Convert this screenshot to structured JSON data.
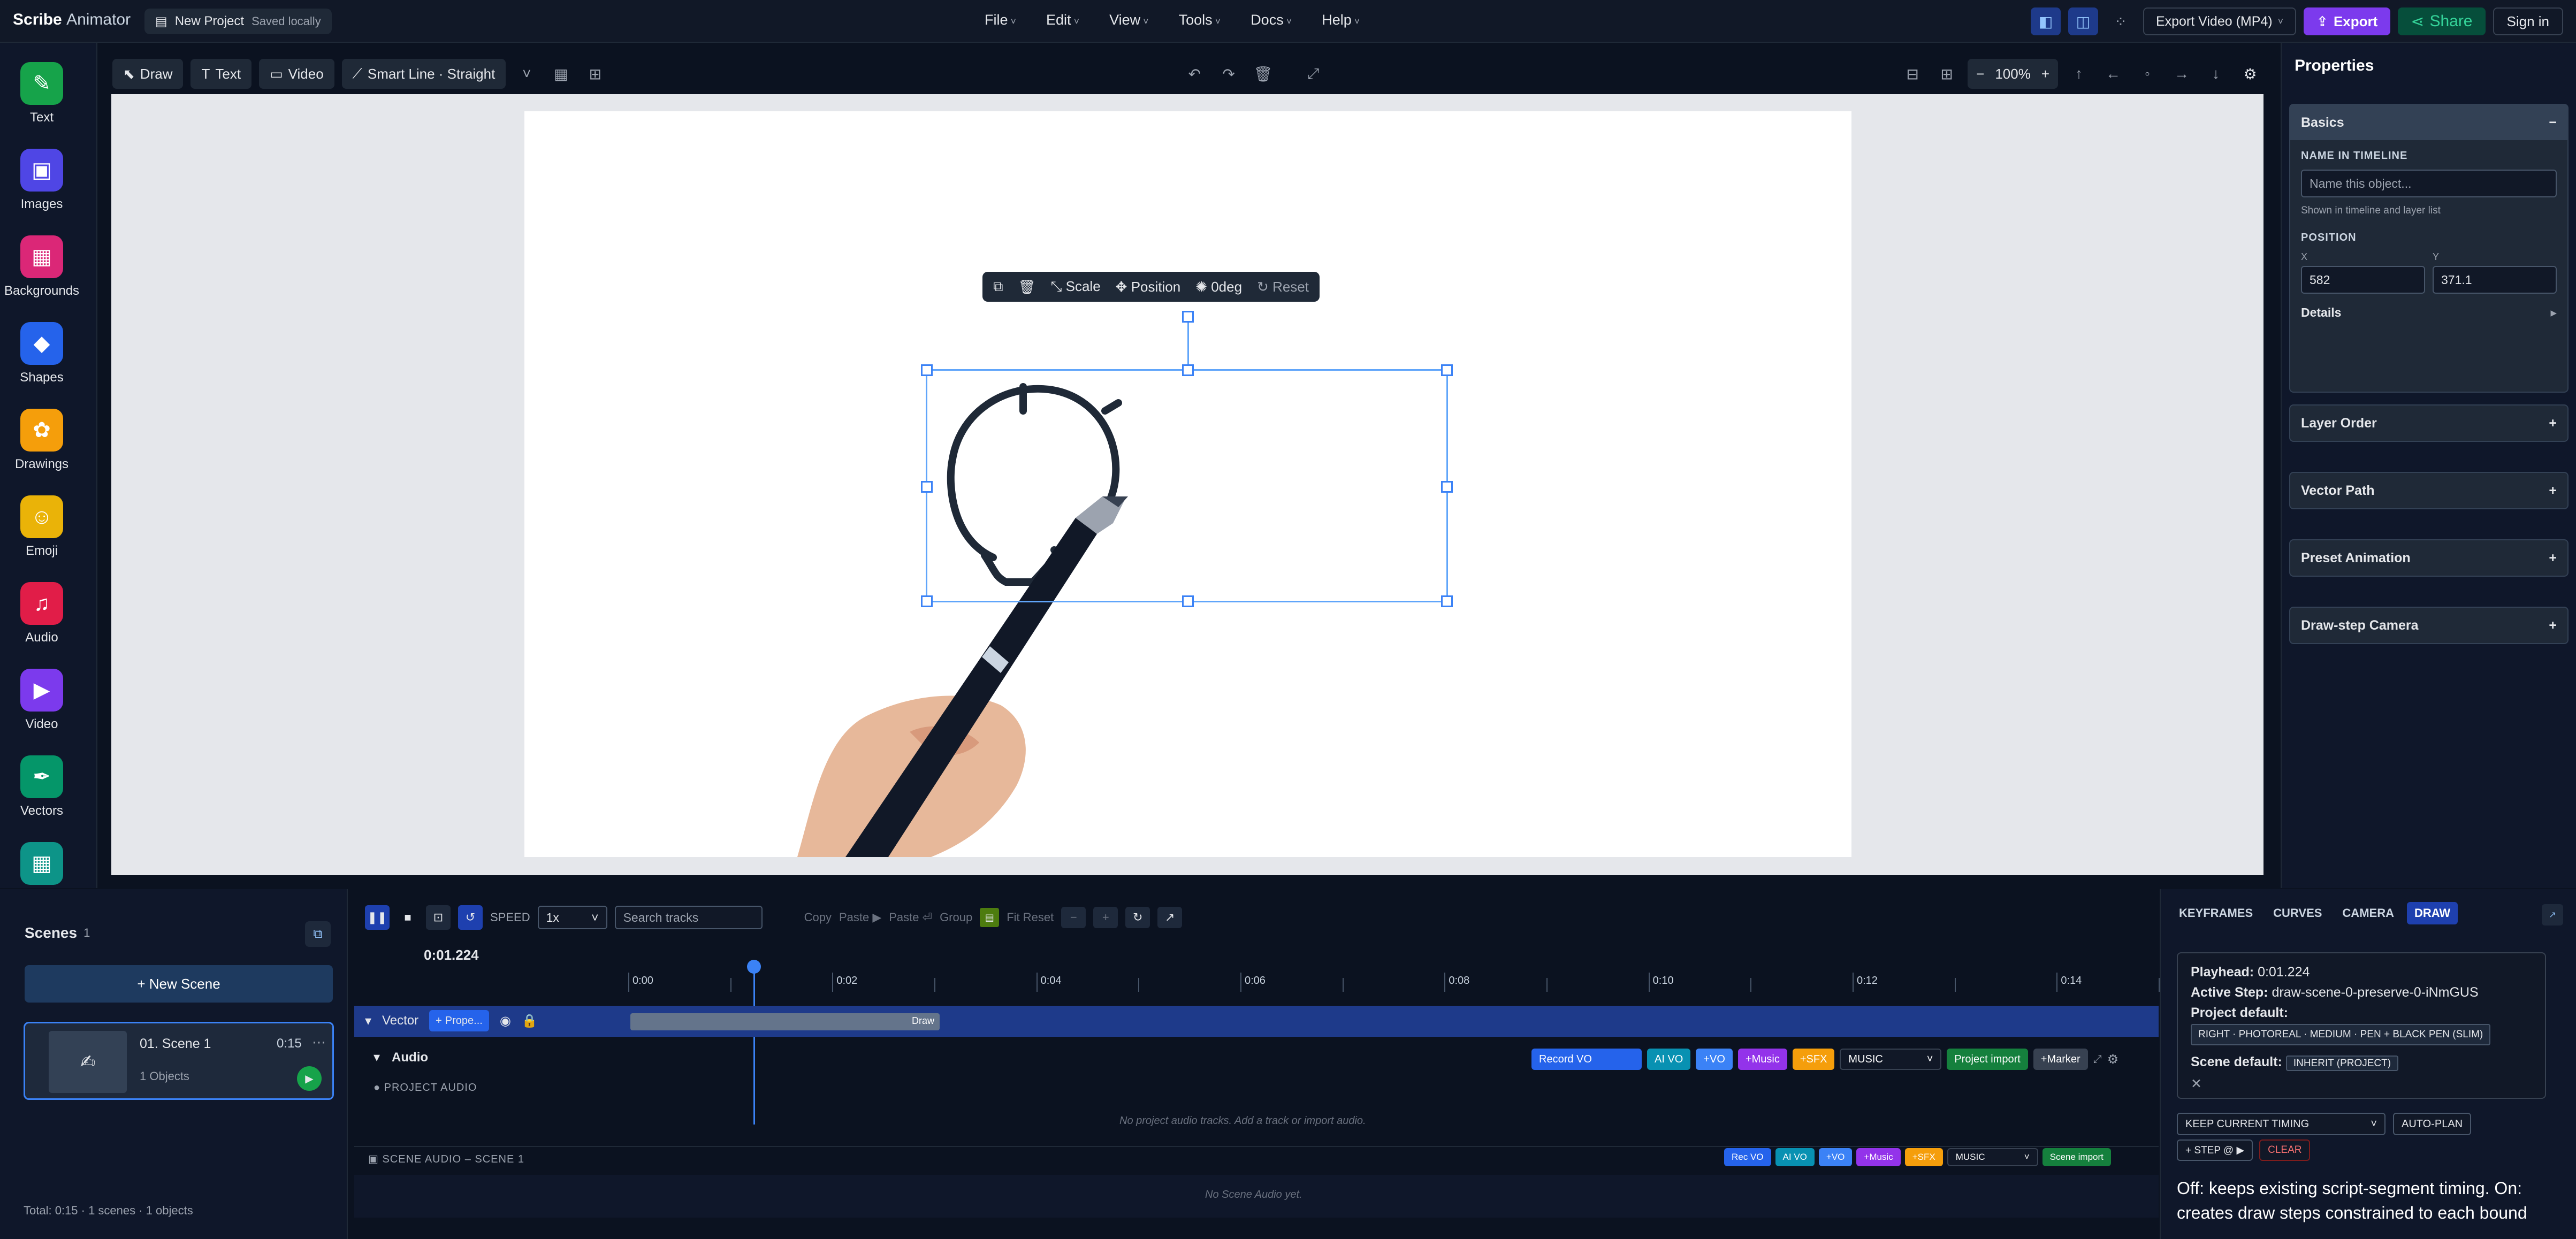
{
  "app": {
    "name_bold": "Scribe",
    "name_rest": "Animator"
  },
  "project": {
    "name": "New Project",
    "status": "Saved locally"
  },
  "menu": [
    "File",
    "Edit",
    "View",
    "Tools",
    "Docs",
    "Help"
  ],
  "topbar": {
    "export_format": "Export Video (MP4)",
    "export_label": "Export",
    "share_label": "Share",
    "signin_label": "Sign in"
  },
  "rail": [
    {
      "label": "Text",
      "color": "#16a34a",
      "glyph": "✎"
    },
    {
      "label": "Images",
      "color": "#4f46e5",
      "glyph": "▣"
    },
    {
      "label": "Backgrounds",
      "color": "#db2777",
      "glyph": "▦"
    },
    {
      "label": "Shapes",
      "color": "#2563eb",
      "glyph": "◆"
    },
    {
      "label": "Drawings",
      "color": "#f59e0b",
      "glyph": "✿"
    },
    {
      "label": "Emoji",
      "color": "#eab308",
      "glyph": "☺"
    },
    {
      "label": "Audio",
      "color": "#e11d48",
      "glyph": "♫"
    },
    {
      "label": "Video",
      "color": "#7c3aed",
      "glyph": "▶"
    },
    {
      "label": "Vectors",
      "color": "#059669",
      "glyph": "✒"
    }
  ],
  "canvas_toolbar": {
    "draw": "Draw",
    "text": "Text",
    "video": "Video",
    "line": "Smart Line · Straight",
    "zoom": "100%"
  },
  "floatbar": {
    "scale": "Scale",
    "position": "Position",
    "rotation": "0deg",
    "reset": "Reset"
  },
  "properties": {
    "title": "Properties",
    "basics": "Basics",
    "name_label": "NAME IN TIMELINE",
    "name_placeholder": "Name this object...",
    "name_hint": "Shown in timeline and layer list",
    "position_label": "POSITION",
    "x_label": "X",
    "y_label": "Y",
    "x": "582",
    "y": "371.1",
    "details": "Details",
    "sections": [
      "Layer Order",
      "Vector Path",
      "Preset Animation",
      "Draw-step Camera"
    ]
  },
  "scenes": {
    "title": "Scenes",
    "count": "1",
    "new_scene": "+ New Scene",
    "item": {
      "index": "01.",
      "name": "Scene 1",
      "duration": "0:15",
      "objects": "1 Objects"
    },
    "total": "Total: 0:15 · 1 scenes · 1 objects"
  },
  "timeline": {
    "speed_label": "SPEED",
    "speed": "1x",
    "search_placeholder": "Search tracks",
    "copy": "Copy",
    "paste": "Paste ▶",
    "paste2": "Paste ⏎",
    "group": "Group",
    "fit": "Fit Reset",
    "time": "0:01.224",
    "ticks": [
      "0:00",
      "0:02",
      "0:04",
      "0:06",
      "0:08",
      "0:10",
      "0:12",
      "0:14"
    ],
    "vector_track": "Vector",
    "prop_chip": "Prope...",
    "clip_label": "Draw",
    "audio_track": "Audio",
    "audio_chips": [
      "Record VO",
      "AI VO",
      "+VO",
      "+Music",
      "+SFX",
      "MUSIC",
      "Project import",
      "+Marker"
    ],
    "project_audio": "PROJECT AUDIO",
    "no_project_audio": "No project audio tracks. Add a track or import audio.",
    "scene_audio": "SCENE AUDIO – SCENE 1",
    "scene_chips": [
      "Rec VO",
      "AI VO",
      "+VO",
      "+Music",
      "+SFX",
      "MUSIC",
      "Scene import"
    ],
    "no_scene_audio": "No Scene Audio yet."
  },
  "inspector": {
    "tabs": [
      "KEYFRAMES",
      "CURVES",
      "CAMERA",
      "DRAW"
    ],
    "playhead_label": "Playhead:",
    "playhead": "0:01.224",
    "active_label": "Active Step:",
    "active": "draw-scene-0-preserve-0-iNmGUS",
    "project_default_label": "Project default:",
    "project_default": "RIGHT · PHOTOREAL · MEDIUM · PEN + BLACK PEN (SLIM)",
    "scene_default_label": "Scene default:",
    "scene_default": "INHERIT (PROJECT)",
    "timing": "KEEP CURRENT TIMING",
    "autoplan": "AUTO-PLAN",
    "step": "+ STEP @ ▶",
    "clear": "CLEAR",
    "note": "Off: keeps existing script-segment timing. On: creates draw steps constrained to each bound"
  }
}
